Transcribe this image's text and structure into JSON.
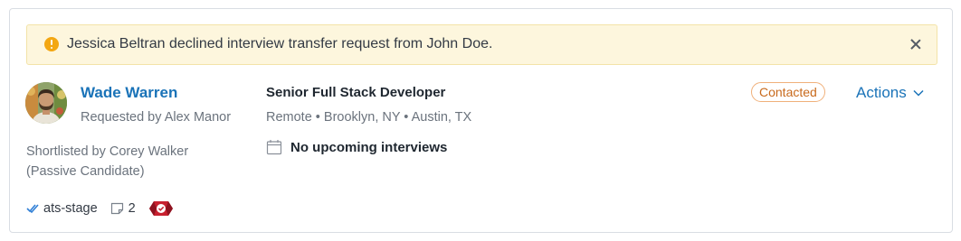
{
  "alert": {
    "message": "Jessica Beltran declined interview transfer request from John Doe.",
    "icon": "warning-icon",
    "close_icon": "close-icon",
    "accent_color": "#f3a712"
  },
  "candidate": {
    "name": "Wade Warren",
    "requested_by": "Requested by Alex Manor",
    "shortlisted_by": "Shortlisted by Corey Walker",
    "candidate_type": "(Passive Candidate)"
  },
  "job": {
    "title": "Senior Full Stack Developer",
    "locations": "Remote • Brooklyn, NY • Austin, TX",
    "interviews_status": "No upcoming interviews"
  },
  "status": {
    "label": "Contacted",
    "color": "#c86a1c"
  },
  "actions": {
    "label": "Actions"
  },
  "tags": {
    "ats_label": "ats-stage",
    "notes_count": "2"
  }
}
